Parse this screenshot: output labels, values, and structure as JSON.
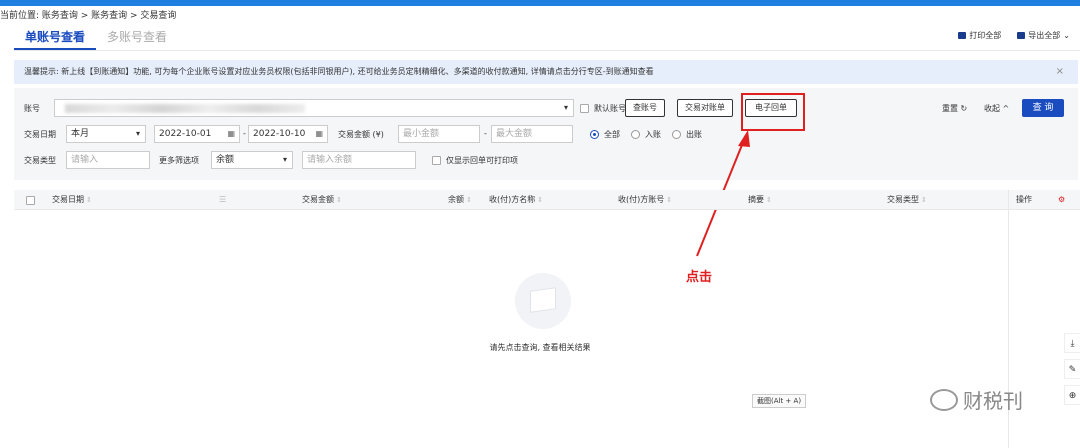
{
  "breadcrumb": "当前位置: 账务查询 > 账务查询 > 交易查询",
  "tabs": [
    "单账号查看",
    "多账号查看"
  ],
  "top_actions": {
    "print": "打印全部",
    "export": "导出全部"
  },
  "notice": {
    "text": "温馨提示: 新上线【到账通知】功能, 可为每个企业账号设置对应业务员权限(包括非同银用户), 还可给业务员定制精细化、多渠道的收付款通知, 详情请点击分行专区-到账通知查看",
    "close": "×"
  },
  "filter": {
    "account_label": "账号",
    "default_account_label": "默认账号",
    "btn_query_account": "查账号",
    "btn_statement": "交易对账单",
    "btn_receipt": "电子回单",
    "reset": "重置",
    "collapse": "收起",
    "query": "查 询",
    "date_label": "交易日期",
    "date_period": "本月",
    "date_from": "2022-10-01",
    "date_to": "2022-10-10",
    "amount_label": "交易金额 (¥)",
    "min_amount_ph": "最小金额",
    "max_amount_ph": "最大金额",
    "dash": "-",
    "radio_all": "全部",
    "radio_in": "入账",
    "radio_out": "出账",
    "type_label": "交易类型",
    "type_ph": "请输入",
    "more_filter_label": "更多筛选项",
    "more_filter_value": "余额",
    "balance_ph": "请输入余额",
    "printable_only": "仅显示回单可打印项"
  },
  "table": {
    "columns": [
      "交易日期",
      "交易金额",
      "余额",
      "收(付)方名称",
      "收(付)方账号",
      "摘要",
      "交易类型",
      "操作"
    ],
    "empty_text": "请先点击查询, 查看相关结果"
  },
  "annotation": "点击",
  "tooltip": "截图(Alt + A)",
  "watermark": "财税刊",
  "icons": {
    "print": "printer-icon",
    "export": "export-icon",
    "calendar": "calendar-icon",
    "reset": "refresh-icon"
  },
  "colors": {
    "accent": "#1a4cc0",
    "annotation": "#e02020",
    "notice_bg": "#e6eefb"
  }
}
